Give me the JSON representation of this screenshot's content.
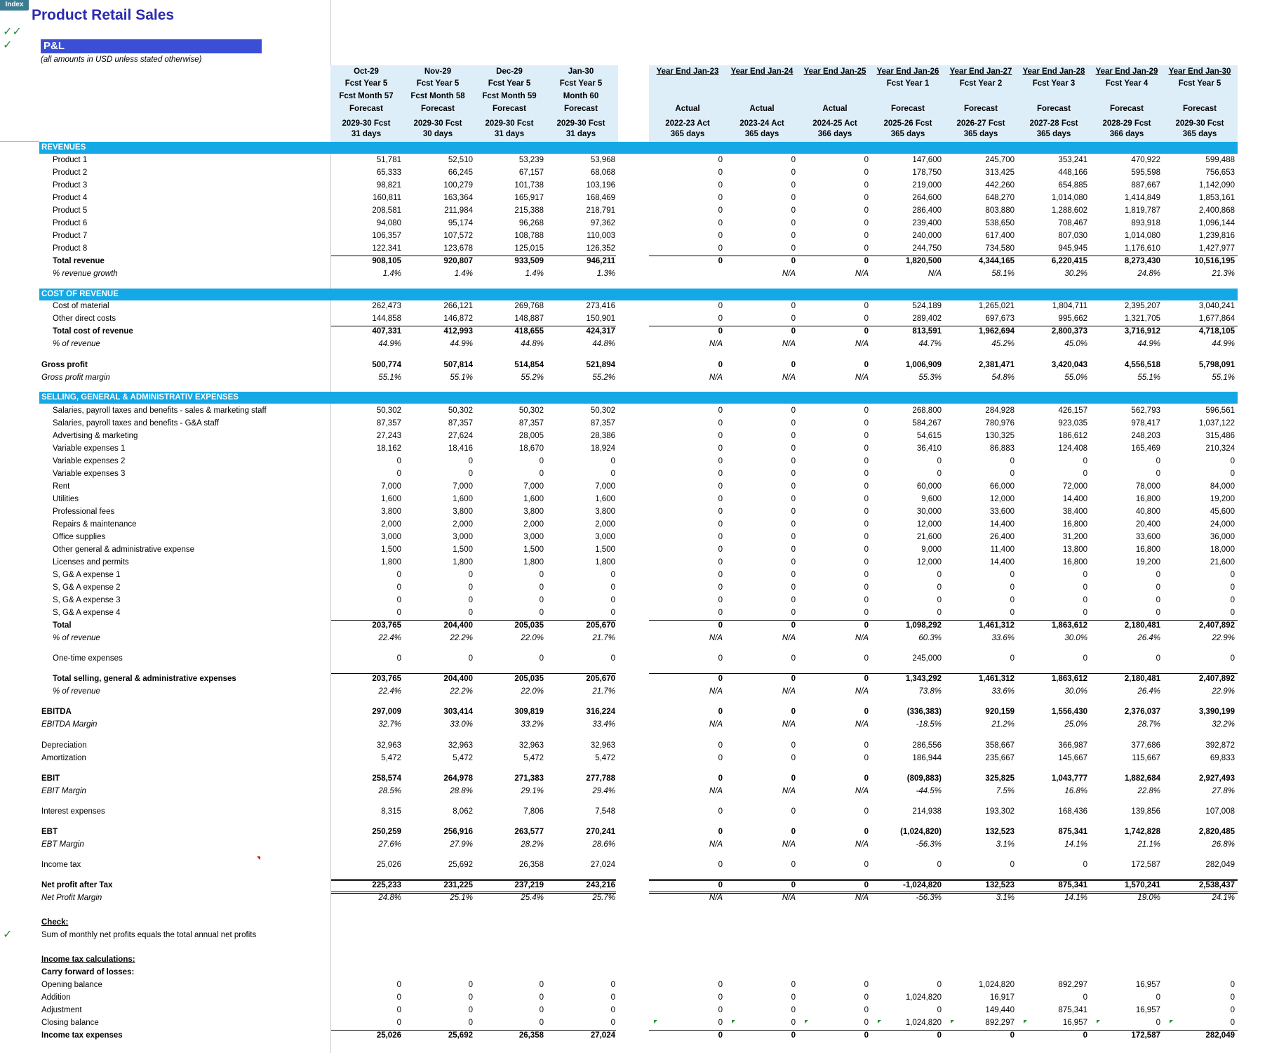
{
  "index_tab": "Index",
  "app_title": "Product Retail Sales",
  "sheet_title": "P&L",
  "subtitle": "(all amounts in USD unless stated otherwise)",
  "check_mark": "✓",
  "double_check_mark": "✓✓",
  "colors": {
    "section_bar": "#14a8e6",
    "title_bar": "#3a4fd6",
    "header_bg": "#ddeef9",
    "title_text": "#2b2bb0",
    "check": "#2e8b3a"
  },
  "monthly_columns": [
    {
      "line1": "Oct-29",
      "line2": "Fcst Year 5",
      "line3": "Fcst Month 57",
      "line4": "Forecast",
      "line5": "2029-30 Fcst",
      "line6": "31 days"
    },
    {
      "line1": "Nov-29",
      "line2": "Fcst Year 5",
      "line3": "Fcst Month 58",
      "line4": "Forecast",
      "line5": "2029-30 Fcst",
      "line6": "30 days"
    },
    {
      "line1": "Dec-29",
      "line2": "Fcst Year 5",
      "line3": "Fcst Month 59",
      "line4": "Forecast",
      "line5": "2029-30 Fcst",
      "line6": "31 days"
    },
    {
      "line1": "Jan-30",
      "line2": "Fcst Year 5",
      "line3": "Month 60",
      "line4": "Forecast",
      "line5": "2029-30 Fcst",
      "line6": "31 days"
    }
  ],
  "annual_columns": [
    {
      "line1": "Year End  Jan-23",
      "line2": "",
      "line4": "Actual",
      "line5": "2022-23 Act",
      "line6": "365 days"
    },
    {
      "line1": "Year End  Jan-24",
      "line2": "",
      "line4": "Actual",
      "line5": "2023-24 Act",
      "line6": "365 days"
    },
    {
      "line1": "Year End  Jan-25",
      "line2": "",
      "line4": "Actual",
      "line5": "2024-25 Act",
      "line6": "366 days"
    },
    {
      "line1": "Year End  Jan-26",
      "line2": "Fcst Year 1",
      "line4": "Forecast",
      "line5": "2025-26 Fcst",
      "line6": "365 days"
    },
    {
      "line1": "Year End  Jan-27",
      "line2": "Fcst Year 2",
      "line4": "Forecast",
      "line5": "2026-27 Fcst",
      "line6": "365 days"
    },
    {
      "line1": "Year End  Jan-28",
      "line2": "Fcst Year 3",
      "line4": "Forecast",
      "line5": "2027-28 Fcst",
      "line6": "365 days"
    },
    {
      "line1": "Year End  Jan-29",
      "line2": "Fcst Year 4",
      "line4": "Forecast",
      "line5": "2028-29 Fcst",
      "line6": "366 days"
    },
    {
      "line1": "Year End  Jan-30",
      "line2": "Fcst Year 5",
      "line4": "Forecast",
      "line5": "2029-30 Fcst",
      "line6": "365 days"
    }
  ],
  "sections": {
    "revenues": "REVENUES",
    "cost_of_revenue": "COST OF REVENUE",
    "sga": "SELLING, GENERAL & ADMINISTRATIV EXPENSES"
  },
  "rows": [
    {
      "label": "Product 1",
      "values": [
        "51,781",
        "52,510",
        "53,239",
        "53,968",
        "0",
        "0",
        "0",
        "147,600",
        "245,700",
        "353,241",
        "470,922",
        "599,488"
      ]
    },
    {
      "label": "Product 2",
      "values": [
        "65,333",
        "66,245",
        "67,157",
        "68,068",
        "0",
        "0",
        "0",
        "178,750",
        "313,425",
        "448,166",
        "595,598",
        "756,653"
      ]
    },
    {
      "label": "Product 3",
      "values": [
        "98,821",
        "100,279",
        "101,738",
        "103,196",
        "0",
        "0",
        "0",
        "219,000",
        "442,260",
        "654,885",
        "887,667",
        "1,142,090"
      ]
    },
    {
      "label": "Product 4",
      "values": [
        "160,811",
        "163,364",
        "165,917",
        "168,469",
        "0",
        "0",
        "0",
        "264,600",
        "648,270",
        "1,014,080",
        "1,414,849",
        "1,853,161"
      ]
    },
    {
      "label": "Product 5",
      "values": [
        "208,581",
        "211,984",
        "215,388",
        "218,791",
        "0",
        "0",
        "0",
        "286,400",
        "803,880",
        "1,288,602",
        "1,819,787",
        "2,400,868"
      ]
    },
    {
      "label": "Product 6",
      "values": [
        "94,080",
        "95,174",
        "96,268",
        "97,362",
        "0",
        "0",
        "0",
        "239,400",
        "538,650",
        "708,467",
        "893,918",
        "1,096,144"
      ]
    },
    {
      "label": "Product 7",
      "values": [
        "106,357",
        "107,572",
        "108,788",
        "110,003",
        "0",
        "0",
        "0",
        "240,000",
        "617,400",
        "807,030",
        "1,014,080",
        "1,239,816"
      ]
    },
    {
      "label": "Product 8",
      "values": [
        "122,341",
        "123,678",
        "125,015",
        "126,352",
        "0",
        "0",
        "0",
        "244,750",
        "734,580",
        "945,945",
        "1,176,610",
        "1,427,977"
      ]
    },
    {
      "label": "Total revenue",
      "values": [
        "908,105",
        "920,807",
        "933,509",
        "946,211",
        "0",
        "0",
        "0",
        "1,820,500",
        "4,344,165",
        "6,220,415",
        "8,273,430",
        "10,516,195"
      ]
    },
    {
      "label": "% revenue growth",
      "values": [
        "1.4%",
        "1.4%",
        "1.4%",
        "1.3%",
        "",
        "N/A",
        "N/A",
        "N/A",
        "58.1%",
        "30.2%",
        "24.8%",
        "21.3%"
      ]
    },
    {
      "label": "Cost of material",
      "values": [
        "262,473",
        "266,121",
        "269,768",
        "273,416",
        "0",
        "0",
        "0",
        "524,189",
        "1,265,021",
        "1,804,711",
        "2,395,207",
        "3,040,241"
      ]
    },
    {
      "label": "Other direct costs",
      "values": [
        "144,858",
        "146,872",
        "148,887",
        "150,901",
        "0",
        "0",
        "0",
        "289,402",
        "697,673",
        "995,662",
        "1,321,705",
        "1,677,864"
      ]
    },
    {
      "label": "Total cost of revenue",
      "values": [
        "407,331",
        "412,993",
        "418,655",
        "424,317",
        "0",
        "0",
        "0",
        "813,591",
        "1,962,694",
        "2,800,373",
        "3,716,912",
        "4,718,105"
      ]
    },
    {
      "label": "% of revenue",
      "values": [
        "44.9%",
        "44.9%",
        "44.8%",
        "44.8%",
        "N/A",
        "N/A",
        "N/A",
        "44.7%",
        "45.2%",
        "45.0%",
        "44.9%",
        "44.9%"
      ]
    },
    {
      "label": "Gross profit",
      "values": [
        "500,774",
        "507,814",
        "514,854",
        "521,894",
        "0",
        "0",
        "0",
        "1,006,909",
        "2,381,471",
        "3,420,043",
        "4,556,518",
        "5,798,091"
      ]
    },
    {
      "label": "Gross profit margin",
      "values": [
        "55.1%",
        "55.1%",
        "55.2%",
        "55.2%",
        "N/A",
        "N/A",
        "N/A",
        "55.3%",
        "54.8%",
        "55.0%",
        "55.1%",
        "55.1%"
      ]
    },
    {
      "label": "Salaries, payroll taxes and benefits - sales & marketing staff",
      "values": [
        "50,302",
        "50,302",
        "50,302",
        "50,302",
        "0",
        "0",
        "0",
        "268,800",
        "284,928",
        "426,157",
        "562,793",
        "596,561"
      ]
    },
    {
      "label": "Salaries, payroll taxes and benefits - G&A staff",
      "values": [
        "87,357",
        "87,357",
        "87,357",
        "87,357",
        "0",
        "0",
        "0",
        "584,267",
        "780,976",
        "923,035",
        "978,417",
        "1,037,122"
      ]
    },
    {
      "label": "Advertising & marketing",
      "values": [
        "27,243",
        "27,624",
        "28,005",
        "28,386",
        "0",
        "0",
        "0",
        "54,615",
        "130,325",
        "186,612",
        "248,203",
        "315,486"
      ]
    },
    {
      "label": "Variable expenses 1",
      "values": [
        "18,162",
        "18,416",
        "18,670",
        "18,924",
        "0",
        "0",
        "0",
        "36,410",
        "86,883",
        "124,408",
        "165,469",
        "210,324"
      ]
    },
    {
      "label": "Variable expenses 2",
      "values": [
        "0",
        "0",
        "0",
        "0",
        "0",
        "0",
        "0",
        "0",
        "0",
        "0",
        "0",
        "0"
      ]
    },
    {
      "label": "Variable expenses 3",
      "values": [
        "0",
        "0",
        "0",
        "0",
        "0",
        "0",
        "0",
        "0",
        "0",
        "0",
        "0",
        "0"
      ]
    },
    {
      "label": "Rent",
      "values": [
        "7,000",
        "7,000",
        "7,000",
        "7,000",
        "0",
        "0",
        "0",
        "60,000",
        "66,000",
        "72,000",
        "78,000",
        "84,000"
      ]
    },
    {
      "label": "Utilities",
      "values": [
        "1,600",
        "1,600",
        "1,600",
        "1,600",
        "0",
        "0",
        "0",
        "9,600",
        "12,000",
        "14,400",
        "16,800",
        "19,200"
      ]
    },
    {
      "label": "Professional fees",
      "values": [
        "3,800",
        "3,800",
        "3,800",
        "3,800",
        "0",
        "0",
        "0",
        "30,000",
        "33,600",
        "38,400",
        "40,800",
        "45,600"
      ]
    },
    {
      "label": "Repairs & maintenance",
      "values": [
        "2,000",
        "2,000",
        "2,000",
        "2,000",
        "0",
        "0",
        "0",
        "12,000",
        "14,400",
        "16,800",
        "20,400",
        "24,000"
      ]
    },
    {
      "label": "Office supplies",
      "values": [
        "3,000",
        "3,000",
        "3,000",
        "3,000",
        "0",
        "0",
        "0",
        "21,600",
        "26,400",
        "31,200",
        "33,600",
        "36,000"
      ]
    },
    {
      "label": "Other general & administrative expense",
      "values": [
        "1,500",
        "1,500",
        "1,500",
        "1,500",
        "0",
        "0",
        "0",
        "9,000",
        "11,400",
        "13,800",
        "16,800",
        "18,000"
      ]
    },
    {
      "label": "Licenses and permits",
      "values": [
        "1,800",
        "1,800",
        "1,800",
        "1,800",
        "0",
        "0",
        "0",
        "12,000",
        "14,400",
        "16,800",
        "19,200",
        "21,600"
      ]
    },
    {
      "label": "S, G& A expense 1",
      "values": [
        "0",
        "0",
        "0",
        "0",
        "0",
        "0",
        "0",
        "0",
        "0",
        "0",
        "0",
        "0"
      ]
    },
    {
      "label": "S, G& A expense 2",
      "values": [
        "0",
        "0",
        "0",
        "0",
        "0",
        "0",
        "0",
        "0",
        "0",
        "0",
        "0",
        "0"
      ]
    },
    {
      "label": "S, G& A expense 3",
      "values": [
        "0",
        "0",
        "0",
        "0",
        "0",
        "0",
        "0",
        "0",
        "0",
        "0",
        "0",
        "0"
      ]
    },
    {
      "label": "S, G& A expense 4",
      "values": [
        "0",
        "0",
        "0",
        "0",
        "0",
        "0",
        "0",
        "0",
        "0",
        "0",
        "0",
        "0"
      ]
    },
    {
      "label": "Total",
      "values": [
        "203,765",
        "204,400",
        "205,035",
        "205,670",
        "0",
        "0",
        "0",
        "1,098,292",
        "1,461,312",
        "1,863,612",
        "2,180,481",
        "2,407,892"
      ]
    },
    {
      "label": "% of revenue",
      "values": [
        "22.4%",
        "22.2%",
        "22.0%",
        "21.7%",
        "N/A",
        "N/A",
        "N/A",
        "60.3%",
        "33.6%",
        "30.0%",
        "26.4%",
        "22.9%"
      ]
    },
    {
      "label": "One-time expenses",
      "values": [
        "0",
        "0",
        "0",
        "0",
        "0",
        "0",
        "0",
        "245,000",
        "0",
        "0",
        "0",
        "0"
      ]
    },
    {
      "label": "Total selling, general & administrative expenses",
      "values": [
        "203,765",
        "204,400",
        "205,035",
        "205,670",
        "0",
        "0",
        "0",
        "1,343,292",
        "1,461,312",
        "1,863,612",
        "2,180,481",
        "2,407,892"
      ]
    },
    {
      "label": "% of revenue",
      "values": [
        "22.4%",
        "22.2%",
        "22.0%",
        "21.7%",
        "N/A",
        "N/A",
        "N/A",
        "73.8%",
        "33.6%",
        "30.0%",
        "26.4%",
        "22.9%"
      ]
    },
    {
      "label": "EBITDA",
      "values": [
        "297,009",
        "303,414",
        "309,819",
        "316,224",
        "0",
        "0",
        "0",
        "(336,383)",
        "920,159",
        "1,556,430",
        "2,376,037",
        "3,390,199"
      ]
    },
    {
      "label": "EBITDA Margin",
      "values": [
        "32.7%",
        "33.0%",
        "33.2%",
        "33.4%",
        "N/A",
        "N/A",
        "N/A",
        "-18.5%",
        "21.2%",
        "25.0%",
        "28.7%",
        "32.2%"
      ]
    },
    {
      "label": "Depreciation",
      "values": [
        "32,963",
        "32,963",
        "32,963",
        "32,963",
        "0",
        "0",
        "0",
        "286,556",
        "358,667",
        "366,987",
        "377,686",
        "392,872"
      ]
    },
    {
      "label": "Amortization",
      "values": [
        "5,472",
        "5,472",
        "5,472",
        "5,472",
        "0",
        "0",
        "0",
        "186,944",
        "235,667",
        "145,667",
        "115,667",
        "69,833"
      ]
    },
    {
      "label": "EBIT",
      "values": [
        "258,574",
        "264,978",
        "271,383",
        "277,788",
        "0",
        "0",
        "0",
        "(809,883)",
        "325,825",
        "1,043,777",
        "1,882,684",
        "2,927,493"
      ]
    },
    {
      "label": "EBIT Margin",
      "values": [
        "28.5%",
        "28.8%",
        "29.1%",
        "29.4%",
        "N/A",
        "N/A",
        "N/A",
        "-44.5%",
        "7.5%",
        "16.8%",
        "22.8%",
        "27.8%"
      ]
    },
    {
      "label": "Interest expenses",
      "values": [
        "8,315",
        "8,062",
        "7,806",
        "7,548",
        "0",
        "0",
        "0",
        "214,938",
        "193,302",
        "168,436",
        "139,856",
        "107,008"
      ]
    },
    {
      "label": "EBT",
      "values": [
        "250,259",
        "256,916",
        "263,577",
        "270,241",
        "0",
        "0",
        "0",
        "(1,024,820)",
        "132,523",
        "875,341",
        "1,742,828",
        "2,820,485"
      ]
    },
    {
      "label": "EBT Margin",
      "values": [
        "27.6%",
        "27.9%",
        "28.2%",
        "28.6%",
        "N/A",
        "N/A",
        "N/A",
        "-56.3%",
        "3.1%",
        "14.1%",
        "21.1%",
        "26.8%"
      ]
    },
    {
      "label": "Income tax",
      "values": [
        "25,026",
        "25,692",
        "26,358",
        "27,024",
        "0",
        "0",
        "0",
        "0",
        "0",
        "0",
        "172,587",
        "282,049"
      ]
    },
    {
      "label": "Net profit after Tax",
      "values": [
        "225,233",
        "231,225",
        "237,219",
        "243,216",
        "0",
        "0",
        "0",
        "-1,024,820",
        "132,523",
        "875,341",
        "1,570,241",
        "2,538,437"
      ]
    },
    {
      "label": "Net Profit Margin",
      "values": [
        "24.8%",
        "25.1%",
        "25.4%",
        "25.7%",
        "N/A",
        "N/A",
        "N/A",
        "-56.3%",
        "3.1%",
        "14.1%",
        "19.0%",
        "24.1%"
      ]
    },
    {
      "label": "Check:",
      "values": []
    },
    {
      "label": "Sum of monthly net profits equals the total annual net profits",
      "values": []
    },
    {
      "label": "Income tax calculations:",
      "values": []
    },
    {
      "label": "Carry forward of losses:",
      "values": []
    },
    {
      "label": "Opening balance",
      "values": [
        "0",
        "0",
        "0",
        "0",
        "0",
        "0",
        "0",
        "0",
        "1,024,820",
        "892,297",
        "16,957",
        "0"
      ]
    },
    {
      "label": "Addition",
      "values": [
        "0",
        "0",
        "0",
        "0",
        "0",
        "0",
        "0",
        "1,024,820",
        "16,917",
        "0",
        "0",
        "0"
      ]
    },
    {
      "label": "Adjustment",
      "values": [
        "0",
        "0",
        "0",
        "0",
        "0",
        "0",
        "0",
        "0",
        "149,440",
        "875,341",
        "16,957",
        "0"
      ]
    },
    {
      "label": "Closing balance",
      "values": [
        "0",
        "0",
        "0",
        "0",
        "0",
        "0",
        "0",
        "1,024,820",
        "892,297",
        "16,957",
        "0",
        "0"
      ]
    },
    {
      "label": "Income tax expenses",
      "values": [
        "25,026",
        "25,692",
        "26,358",
        "27,024",
        "0",
        "0",
        "0",
        "0",
        "0",
        "0",
        "172,587",
        "282,049"
      ]
    }
  ]
}
